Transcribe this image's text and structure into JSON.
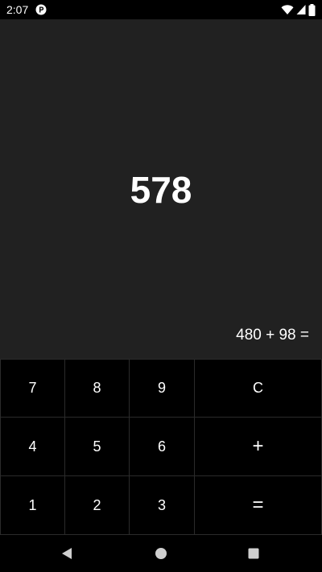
{
  "status_bar": {
    "time": "2:07",
    "app_icon": "p-badge-icon",
    "indicators": [
      "wifi-icon",
      "cell-signal-icon",
      "battery-icon"
    ]
  },
  "display": {
    "result": "578",
    "expression": "480 + 98 ="
  },
  "keypad": {
    "keys": [
      "7",
      "8",
      "9",
      "C",
      "4",
      "5",
      "6",
      "+",
      "1",
      "2",
      "3",
      "="
    ]
  },
  "nav_bar": {
    "buttons": [
      "back-icon",
      "home-icon",
      "recents-icon"
    ]
  },
  "colors": {
    "display_bg": "#212121",
    "keypad_bg": "#000000",
    "key_border": "#2b2b2b",
    "text": "#ffffff",
    "nav_icon": "#cfcfcf"
  }
}
